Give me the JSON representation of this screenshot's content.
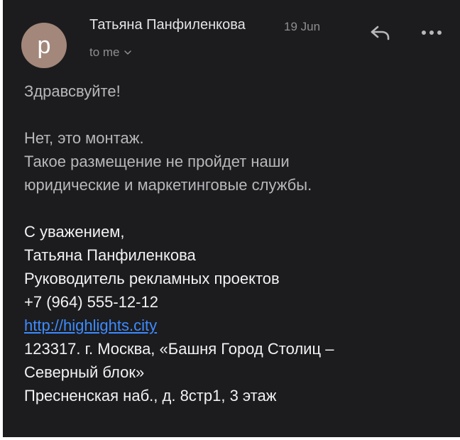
{
  "header": {
    "avatar_letter": "p",
    "sender_name": "Татьяна Панфиленкова",
    "date": "19 Jun",
    "recipient": "to me"
  },
  "message": {
    "greeting": "Здравсвуйте!",
    "body_lines": [
      "Нет, это монтаж.",
      "Такое размещение не пройдет наши",
      "юридические и маркетинговые службы."
    ],
    "signature": {
      "closing": "С уважением,",
      "name": "Татьяна Панфиленкова",
      "title": "Руководитель рекламных проектов",
      "phone": "+7 (964) 555-12-12",
      "website": "http://highlights.city",
      "address_line1": "123317. г. Москва, «Башня Город Столиц –",
      "address_line2": "Северный блок»",
      "address_line3": "Пресненская наб., д. 8стр1, 3 этаж"
    }
  },
  "colors": {
    "background": "#1c1c1e",
    "avatar": "#a3877a",
    "link": "#3d8bff",
    "secondary_text": "#8e8e93"
  },
  "icons": [
    "reply-icon",
    "more-icon",
    "chevron-down-icon"
  ]
}
